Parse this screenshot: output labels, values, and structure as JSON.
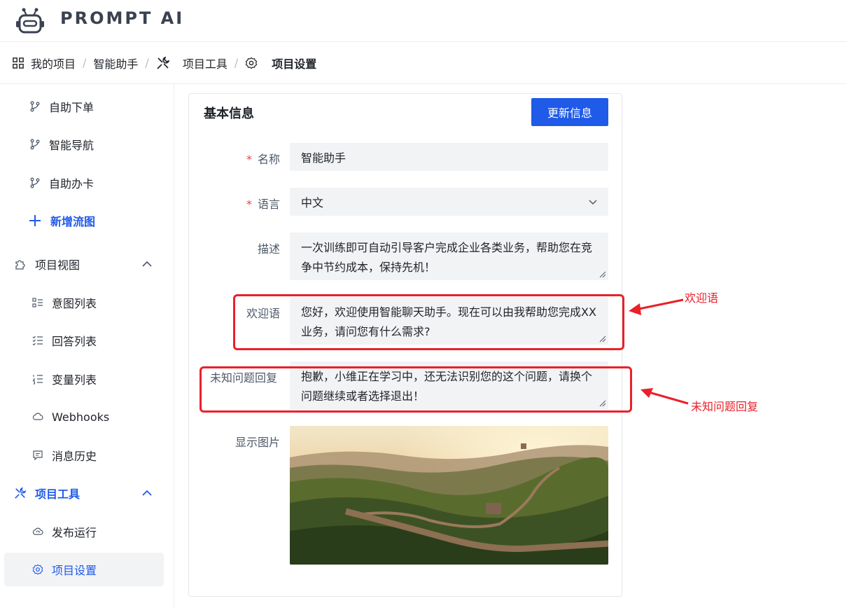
{
  "app": {
    "title": "PROMPT AI",
    "logo_icon": "robot-icon"
  },
  "breadcrumb": {
    "items": [
      {
        "label": "我的项目",
        "icon": "grid-icon"
      },
      {
        "label": "智能助手",
        "icon": ""
      },
      {
        "label": "项目工具",
        "icon": "tools-icon"
      },
      {
        "label": "项目设置",
        "icon": "gear-icon"
      }
    ],
    "separator": "/"
  },
  "sidebar": {
    "items": [
      {
        "label": "自助下单",
        "icon": "branch-icon"
      },
      {
        "label": "智能导航",
        "icon": "branch-icon"
      },
      {
        "label": "自助办卡",
        "icon": "branch-icon"
      },
      {
        "label": "新增流图",
        "icon": "plus-icon"
      },
      {
        "label": "项目视图",
        "icon": "puzzle-icon"
      },
      {
        "label": "意图列表",
        "icon": "list-icon"
      },
      {
        "label": "回答列表",
        "icon": "checklist-icon"
      },
      {
        "label": "变量列表",
        "icon": "numbered-list-icon"
      },
      {
        "label": "Webhooks",
        "icon": "cloud-icon"
      },
      {
        "label": "消息历史",
        "icon": "chat-icon"
      },
      {
        "label": "项目工具",
        "icon": "tools-icon"
      },
      {
        "label": "发布运行",
        "icon": "cloud-sync-icon"
      },
      {
        "label": "项目设置",
        "icon": "gear-icon"
      }
    ]
  },
  "card": {
    "title": "基本信息",
    "update_button": "更新信息",
    "required_mark": "*",
    "fields": {
      "name": {
        "label": "名称",
        "value": "智能助手"
      },
      "language": {
        "label": "语言",
        "value": "中文"
      },
      "description": {
        "label": "描述",
        "value": "一次训练即可自动引导客户完成企业各类业务，帮助您在竞争中节约成本，保持先机！"
      },
      "welcome": {
        "label": "欢迎语",
        "value": "您好，欢迎使用智能聊天助手。现在可以由我帮助您完成XX业务，请问您有什么需求?"
      },
      "unknown": {
        "label": "未知问题回复",
        "value": "抱歉，小维正在学习中，还无法识别您的这个问题，请换个问题继续或者选择退出！"
      },
      "image": {
        "label": "显示图片"
      }
    }
  },
  "annotations": {
    "welcome_note": "欢迎语",
    "unknown_note": "未知问题回复",
    "color": "#e8212a"
  },
  "colors": {
    "accent": "#1f5ae8",
    "required": "#f53f3f"
  }
}
